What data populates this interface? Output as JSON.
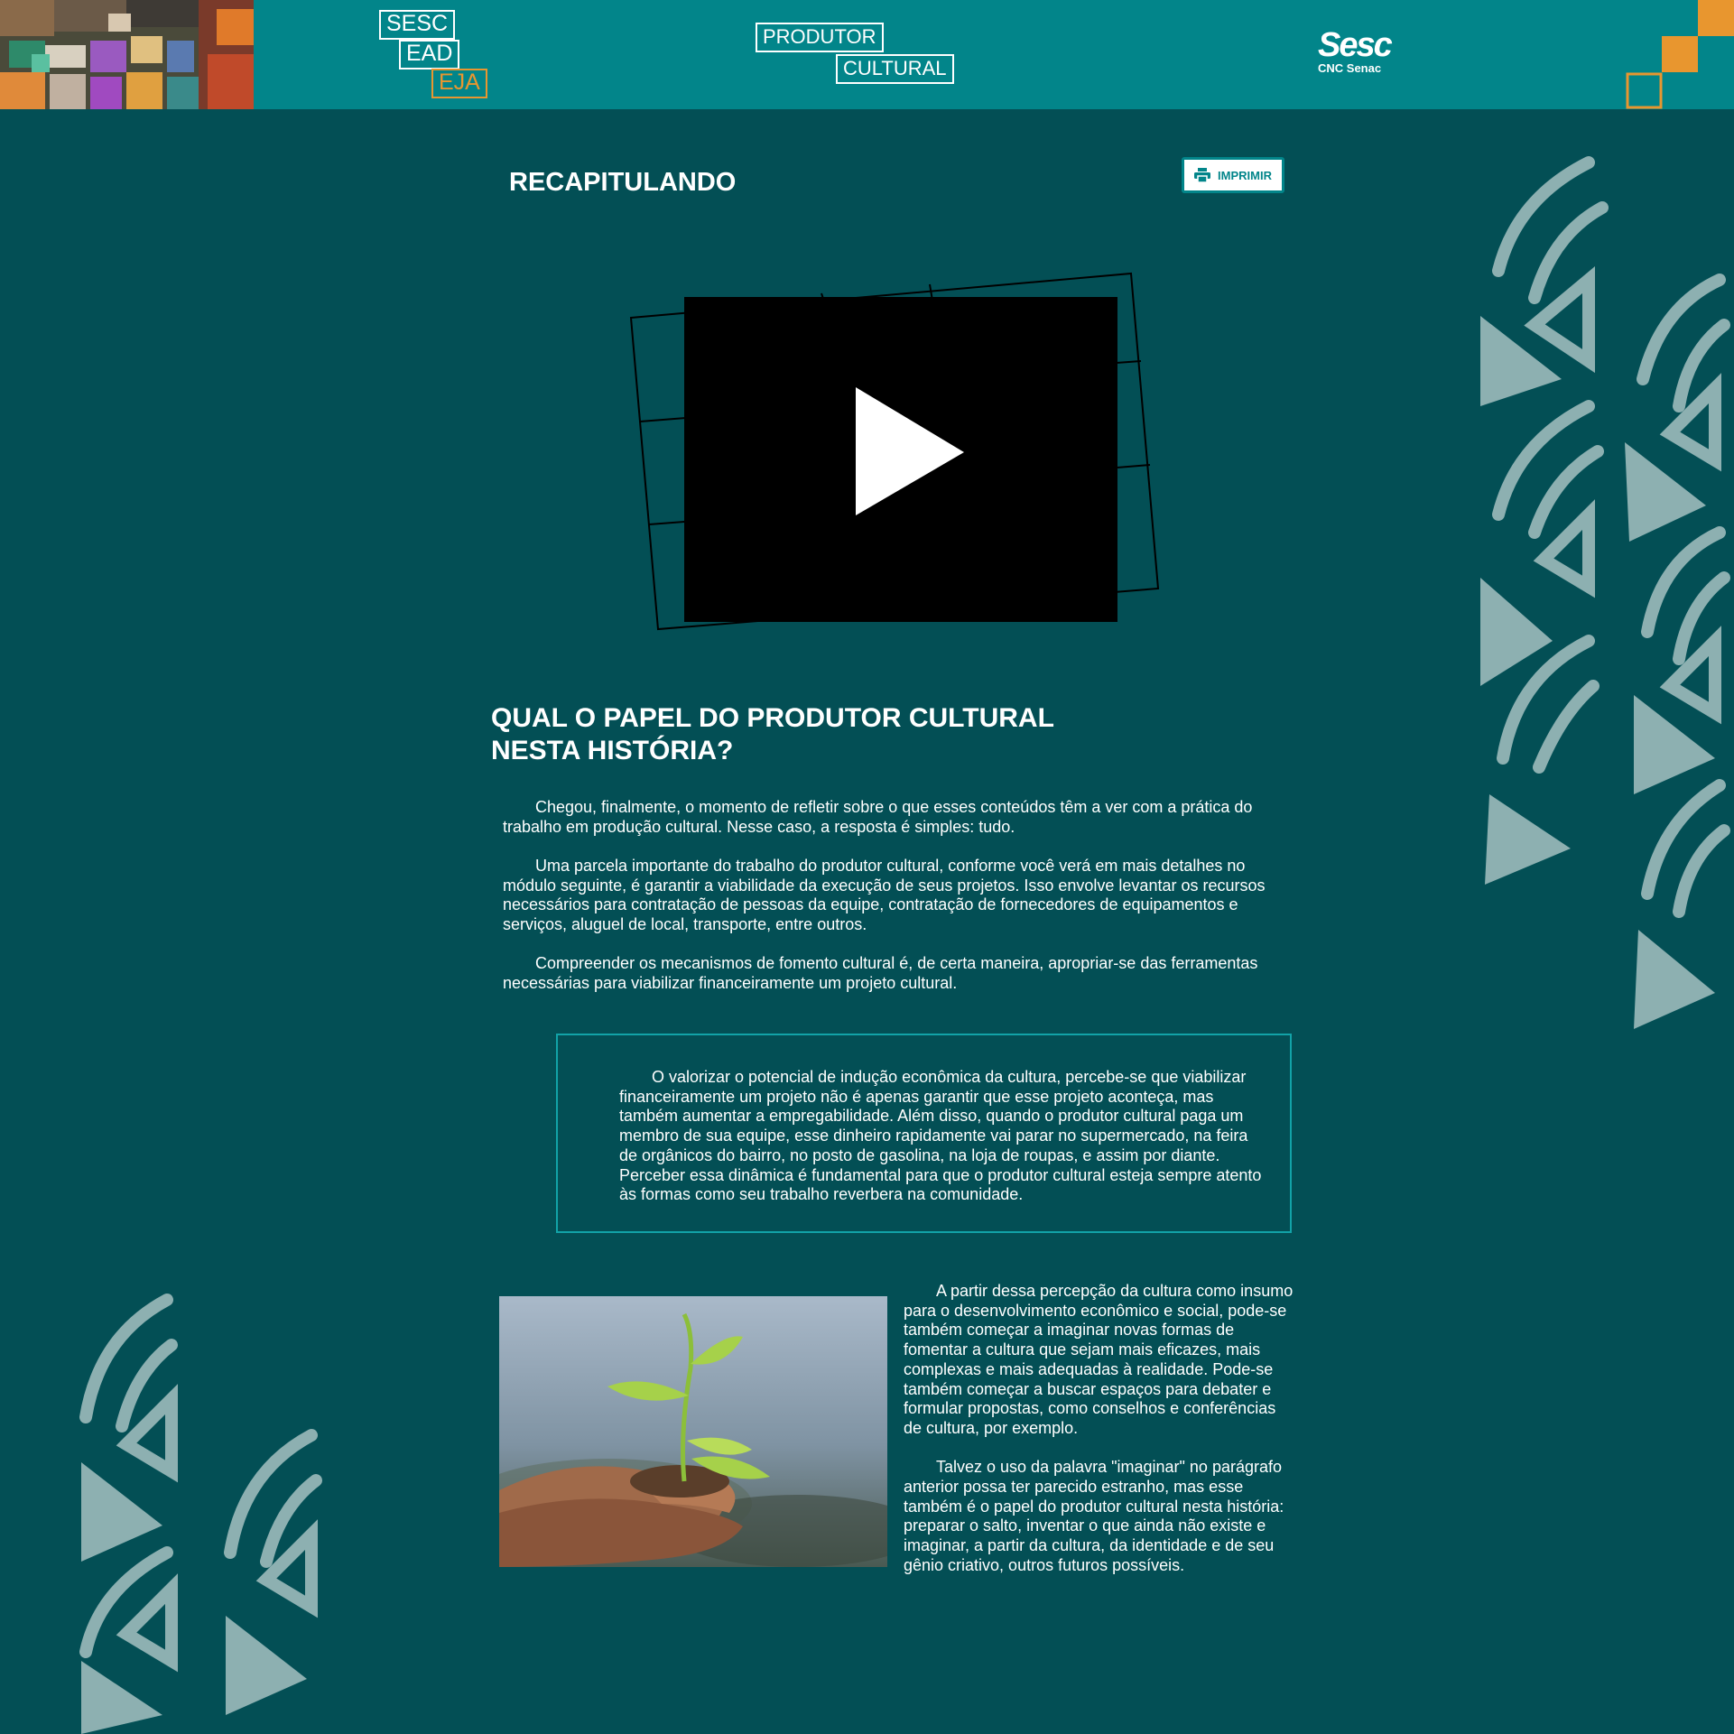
{
  "header": {
    "logo_sesc_ead": {
      "line1": "SESC",
      "line2": "EAD",
      "line3": "EJA"
    },
    "logo_produtor_cultural": {
      "line1": "PRODUTOR",
      "line2": "CULTURAL"
    },
    "brand": {
      "name": "Sesc",
      "sub": "CNC Senac"
    }
  },
  "colors": {
    "page_background": "#034f55",
    "header_background": "#02858a",
    "accent_orange": "#e8962f",
    "pattern": "#8db0b1",
    "quote_border": "#12a3a8"
  },
  "section_title": "RECAPITULANDO",
  "print_button": {
    "label": "IMPRIMIR",
    "icon": "printer-icon"
  },
  "video": {
    "icon": "play-icon"
  },
  "main": {
    "heading_line1": "QUAL O PAPEL DO PRODUTOR CULTURAL",
    "heading_line2": "NESTA HISTÓRIA?",
    "paragraphs": [
      "Chegou, finalmente, o momento de refletir sobre o que esses conteúdos têm a ver com a prática do trabalho em produção cultural. Nesse caso, a resposta é simples: tudo.",
      "Uma parcela importante do trabalho do produtor cultural, conforme você verá em mais detalhes no módulo seguinte, é garantir a viabilidade da execução de seus projetos. Isso envolve levantar os recursos necessários para contratação de pessoas da equipe, contratação de fornecedores de equipamentos e serviços, aluguel de local, transporte, entre outros.",
      "Compreender os mecanismos de fomento cultural é, de certa maneira, apropriar-se das ferramentas necessárias para viabilizar financeiramente um projeto cultural."
    ]
  },
  "quote": "O valorizar o potencial de indução econômica da cultura, percebe-se que viabilizar financeiramente um projeto não é apenas garantir que esse projeto aconteça, mas também aumentar a empregabilidade. Além disso, quando o produtor cultural paga um membro de sua equipe, esse dinheiro rapidamente vai parar no supermercado, na feira de orgânicos do bairro, no posto de gasolina, na loja de roupas, e assim por diante. Perceber essa dinâmica é fundamental para que o produtor cultural esteja sempre atento às formas como seu trabalho reverbera na comunidade.",
  "side_paragraphs": [
    "A partir dessa percepção da cultura como insumo para o desenvolvimento econômico e social, pode-se também começar a imaginar novas formas de fomentar a cultura que sejam mais eficazes, mais complexas e mais adequadas à realidade. Pode-se também começar a buscar espaços para debater e formular propostas, como conselhos e conferências de cultura, por exemplo.",
    "Talvez o uso da palavra \"imaginar\" no parágrafo anterior possa ter parecido estranho, mas esse também é o papel do produtor cultural nesta história: preparar o salto, inventar o que ainda não existe e imaginar, a partir da cultura, da identidade e de seu gênio criativo, outros futuros possíveis."
  ]
}
